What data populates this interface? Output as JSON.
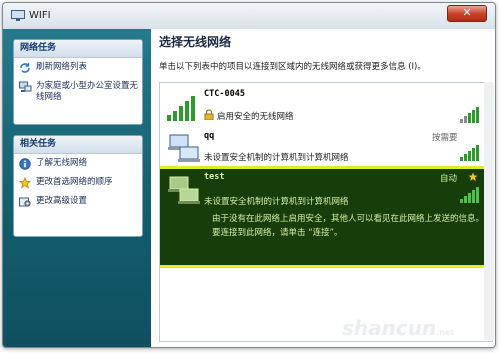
{
  "window": {
    "title": "WIFI",
    "close_glyph": "✕"
  },
  "sidebar": {
    "network_tasks": {
      "header": "网络任务",
      "items": [
        {
          "label": "刷新网络列表",
          "icon": "refresh-icon"
        },
        {
          "label": "为家庭或小型办公室设置无线网络",
          "icon": "setup-network-icon"
        }
      ]
    },
    "related_tasks": {
      "header": "相关任务",
      "items": [
        {
          "label": "了解无线网络",
          "icon": "info-icon"
        },
        {
          "label": "更改首选网络的顺序",
          "icon": "star-icon"
        },
        {
          "label": "更改高级设置",
          "icon": "settings-icon"
        }
      ]
    }
  },
  "main": {
    "title": "选择无线网络",
    "description": "单击以下列表中的项目以连接到区域内的无线网络或获得更多信息 (I)。",
    "networks": [
      {
        "name": "CTC-0045",
        "security": "启用安全的无线网络",
        "status": ""
      },
      {
        "name": "qq",
        "security": "未设置安全机制的计算机到计算机网络",
        "status": "按需要"
      },
      {
        "name": "test",
        "security": "未设置安全机制的计算机到计算机网络",
        "status": "自动",
        "warning_line1": "由于没有在此网络上启用安全，其他人可以看见在此网络上发送的信息。",
        "warning_line2": "要连接到此网络，请单击 “连接”。"
      }
    ]
  },
  "watermark": {
    "text": "shancun",
    "sub": ".net"
  },
  "colors": {
    "selected_bg": "#173d0a",
    "highlight": "#ddee22",
    "sidebar": "#135c6c",
    "signal": "#2e9a2e"
  }
}
